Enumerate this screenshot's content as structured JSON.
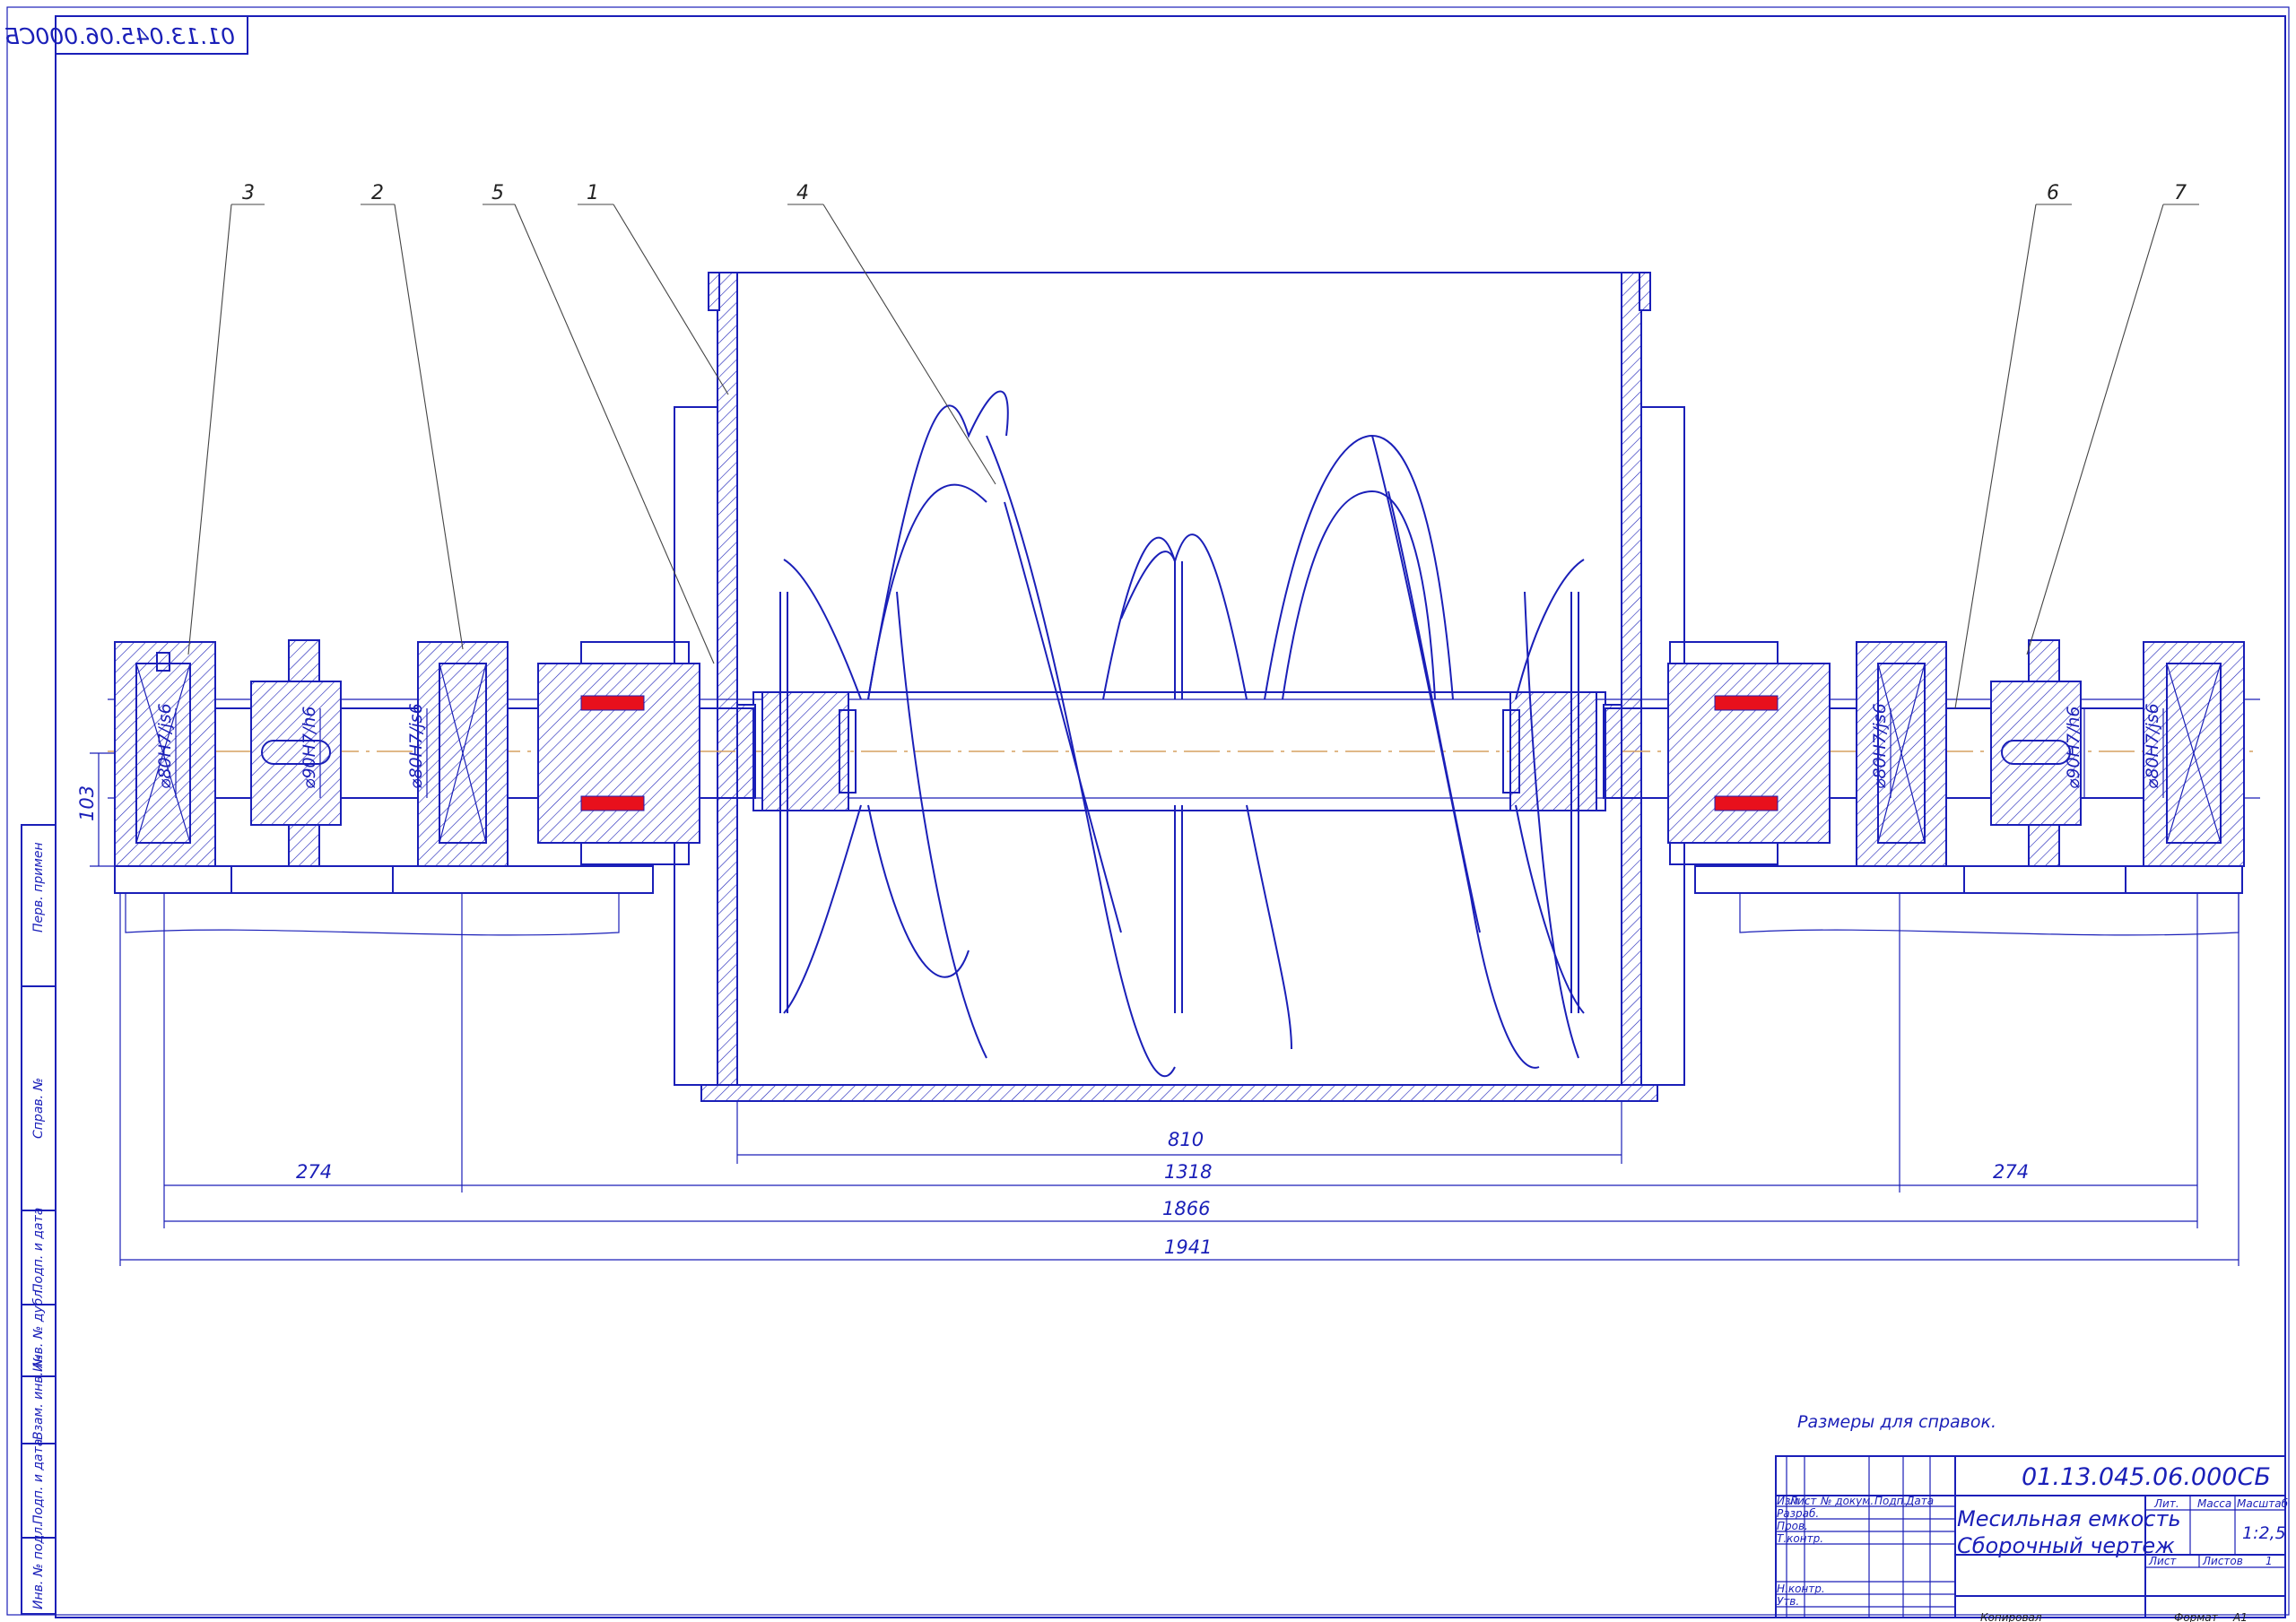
{
  "drawing": {
    "mirrored_code": "01.13.045.06.000СБ",
    "note": "Размеры для справок.",
    "part_labels": [
      "3",
      "2",
      "5",
      "1",
      "4",
      "6",
      "7"
    ],
    "fits": {
      "left_bearing": "⌀80H7/js6",
      "left_pulley": "⌀90H7/h6",
      "left_inner_bearing": "⌀80H7/js6",
      "right_inner_bearing": "⌀80H7/js6",
      "right_pulley": "⌀90H7/h6",
      "right_bearing": "⌀80H7/js6"
    },
    "dimensions": {
      "height": "103",
      "d810": "810",
      "d274_left": "274",
      "d1318": "1318",
      "d274_right": "274",
      "d1866": "1866",
      "d1941": "1941"
    },
    "side_stamp": [
      "Перв. примен",
      "Справ. №",
      "Подп. и дата",
      "Инв. № дубл.",
      "Взам. инв. №",
      "Подп. и дата",
      "Инв. № подл."
    ],
    "title_block": {
      "code": "01.13.045.06.000СБ",
      "title_line1": "Месильная емкость",
      "title_line2": "Сборочный чертеж",
      "col_headers": [
        "Изм",
        "Лист",
        "№ докум.",
        "Подп.",
        "Дата"
      ],
      "roles": [
        "Разраб.",
        "Пров.",
        "Т.контр.",
        "Н.контр.",
        "Утв."
      ],
      "lit": "Лит.",
      "mass": "Масса",
      "scale_label": "Масштаб",
      "scale": "1:2,5",
      "sheet": "Лист",
      "sheets": "Листов",
      "sheets_count": "1",
      "copied": "Копировал",
      "format_label": "Формат",
      "format": "A1"
    }
  }
}
